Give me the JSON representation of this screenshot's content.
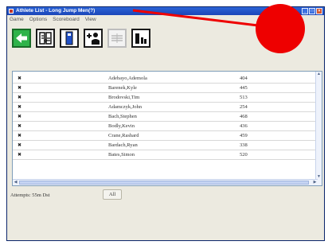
{
  "window": {
    "title": "Athlete List - Long Jump Men(?)",
    "controls": [
      "_",
      "□",
      "×"
    ]
  },
  "menu": {
    "items": [
      "Game",
      "Options",
      "Scoreboard",
      "View"
    ]
  },
  "toolbar": {
    "buttons": [
      {
        "icon": "back-arrow-icon",
        "enabled": true
      },
      {
        "icon": "athlete-swap-icon",
        "enabled": true
      },
      {
        "icon": "bar-column-icon",
        "enabled": true
      },
      {
        "icon": "add-athlete-icon",
        "enabled": true
      },
      {
        "icon": "reorder-icon",
        "enabled": false
      },
      {
        "icon": "results-chart-icon",
        "enabled": true
      }
    ]
  },
  "athletes": [
    {
      "name": "Adebayo,Ademola",
      "number": "404"
    },
    {
      "name": "Barenek,Kyle",
      "number": "445"
    },
    {
      "name": "Brodovski,Tim",
      "number": "513"
    },
    {
      "name": "Adamczyk,John",
      "number": "254"
    },
    {
      "name": "Bach,Stephen",
      "number": "468"
    },
    {
      "name": "Bodly,Kevin",
      "number": "436"
    },
    {
      "name": "Crane,Rashard",
      "number": "459"
    },
    {
      "name": "Bardach,Ryan",
      "number": "338"
    },
    {
      "name": "Bates,Simon",
      "number": "520"
    }
  ],
  "footer": {
    "attempts_label": "Attempts: 55m Dst",
    "all_button": "All"
  },
  "colors": {
    "annotation_red": "#ee0000",
    "titlebar_blue": "#1b45b8",
    "back_button_green": "#2fb34a"
  }
}
